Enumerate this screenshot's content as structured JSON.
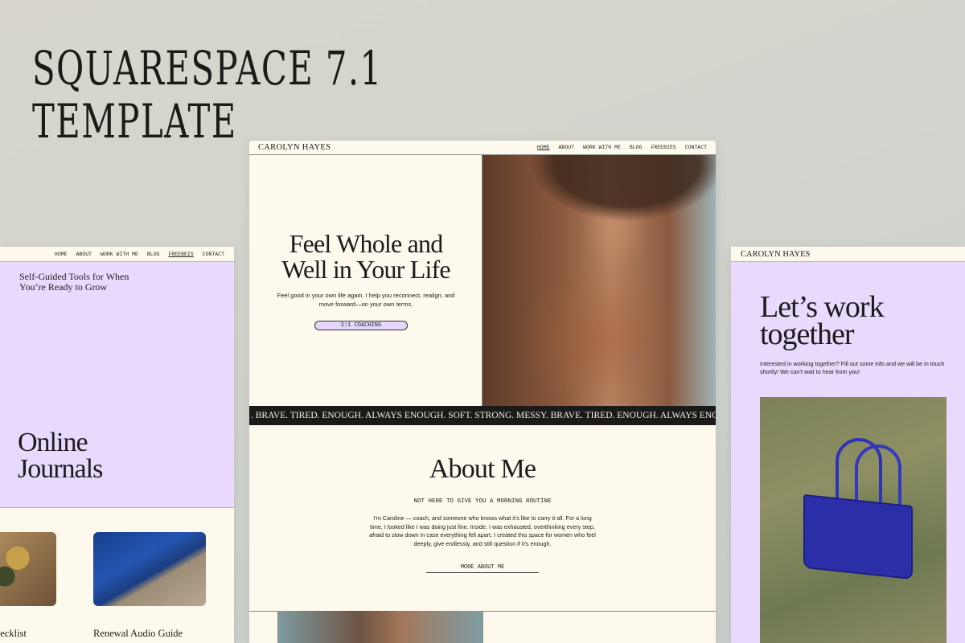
{
  "headline": {
    "line1": "SQUARESPACE 7.1",
    "line2": "TEMPLATE"
  },
  "left_page": {
    "nav": [
      "HOME",
      "ABOUT",
      "WORK WITH ME",
      "BLOG",
      "FREEBEIS",
      "CONTACT"
    ],
    "nav_active": "FREEBEIS",
    "subtitle": "Self-Guided Tools for When You’re Ready to Grow",
    "title_line1": "Online",
    "title_line2": "Journals",
    "captions": [
      "hecklist",
      "Renewal Audio Guide"
    ]
  },
  "center_page": {
    "brand": "CAROLYN HAYES",
    "nav": [
      "HOME",
      "ABOUT",
      "WORK WITH ME",
      "BLOG",
      "FREEBIES",
      "CONTACT"
    ],
    "nav_active": "HOME",
    "hero_title_line1": "Feel Whole and",
    "hero_title_line2": "Well in Your Life",
    "hero_text": "Feel good in your own life again.  I help you reconnect, realign, and move forward—on your own terms.",
    "hero_button": "1:1 COACHING",
    "marquee": ". BRAVE. TIRED. ENOUGH. ALWAYS ENOUGH. SOFT. STRONG. MESSY. BRAVE. TIRED. ENOUGH. ALWAYS ENOUGH. SOFT. STRONG. M",
    "about_title": "About Me",
    "about_subtitle": "NOT HERE TO GIVE YOU A MORNING ROUTINE",
    "about_body": "I’m Caroline — coach, and someone who knows what it’s like to carry it all. For a long time, I looked like I was doing just fine. Inside, I was exhausted, overthinking every step, afraid to slow down in case everything fell apart. I created this space for women who feel deeply, give endlessly, and still question if it’s enough.",
    "about_link": "MORE ABOUT ME"
  },
  "right_page": {
    "brand": "CAROLYN HAYES",
    "title_line1": "Let’s work",
    "title_line2": "together",
    "text": "Interested in working together? Fill out some info and we will be in touch shortly! We can’t wait to hear from you!"
  },
  "colors": {
    "background": "#d3d4cc",
    "cream": "#fdf9ec",
    "lavender": "#e8d9fd",
    "ink": "#1c1c1c"
  }
}
